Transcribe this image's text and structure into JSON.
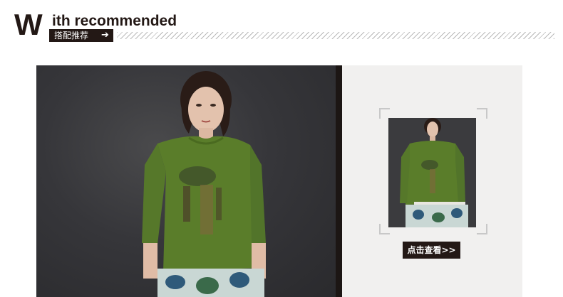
{
  "header": {
    "title_initial": "W",
    "title_rest": "ith recommended",
    "subtitle": "搭配推荐",
    "arrow_glyph": "➔"
  },
  "product": {
    "main_image_icon": "model-photo-green-top",
    "thumbnail_icon": "model-thumbnail-green-top",
    "view_button_label": "点击查看>>"
  },
  "colors": {
    "accent_dark": "#231815",
    "panel_bg": "#f1f0ef",
    "shirt_green": "#5a7d2a"
  }
}
